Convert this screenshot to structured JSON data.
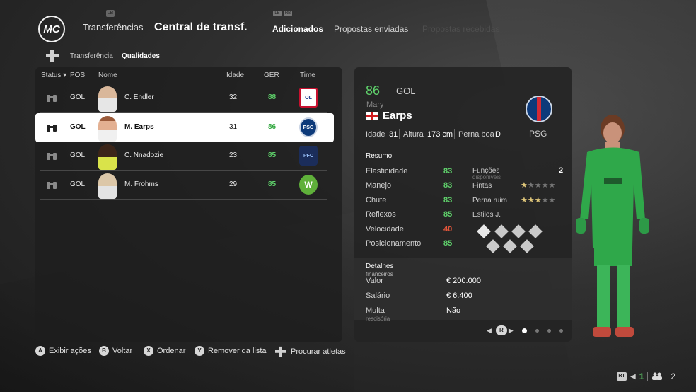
{
  "header": {
    "logo": "MC",
    "transfer_label": "Transferências",
    "title": "Central de transf.",
    "tabs": [
      "Adicionados",
      "Propostas enviadas",
      "Propostas recebidas"
    ]
  },
  "subtabs": [
    "Transferência",
    "Qualidades"
  ],
  "table": {
    "columns": [
      "Status",
      "POS",
      "Nome",
      "Idade",
      "GER",
      "Time"
    ],
    "rows": [
      {
        "pos": "GOL",
        "name": "C. Endler",
        "age": "32",
        "ger": "88",
        "team": "OL"
      },
      {
        "pos": "GOL",
        "name": "M. Earps",
        "age": "31",
        "ger": "86",
        "team": "PSG"
      },
      {
        "pos": "GOL",
        "name": "C. Nnadozie",
        "age": "23",
        "ger": "85",
        "team": "PFC"
      },
      {
        "pos": "GOL",
        "name": "M. Frohms",
        "age": "29",
        "ger": "85",
        "team": "W"
      }
    ]
  },
  "player": {
    "rating": "86",
    "position": "GOL",
    "first_name": "Mary",
    "last_name": "Earps",
    "age_label": "Idade",
    "age": "31",
    "height_label": "Altura",
    "height": "173 cm",
    "foot_label": "Perna boa",
    "foot": "D",
    "club": "PSG",
    "summary_title": "Resumo",
    "attributes": [
      {
        "label": "Elasticidade",
        "value": "83"
      },
      {
        "label": "Manejo",
        "value": "83"
      },
      {
        "label": "Chute",
        "value": "83"
      },
      {
        "label": "Reflexos",
        "value": "85"
      },
      {
        "label": "Velocidade",
        "value": "40"
      },
      {
        "label": "Posicionamento",
        "value": "85"
      }
    ],
    "functions_label": "Funções",
    "functions_sub": "disponíveis",
    "functions_value": "2",
    "skill_label": "Fintas",
    "skill_stars": 1,
    "weak_foot_label": "Perna ruim",
    "weak_foot_stars": 3,
    "styles_label": "Estilos J.",
    "finance_title": "Detalhes",
    "finance_sub": "financeiros",
    "value_label": "Valor",
    "value": "€ 200.000",
    "salary_label": "Salário",
    "salary": "€ 6.400",
    "release_label": "Multa",
    "release_sub": "rescisória",
    "release": "Não"
  },
  "hints": [
    {
      "btn": "A",
      "label": "Exibir ações"
    },
    {
      "btn": "B",
      "label": "Voltar"
    },
    {
      "btn": "X",
      "label": "Ordenar"
    },
    {
      "btn": "Y",
      "label": "Remover da lista"
    },
    {
      "btn": "",
      "label": "Procurar atletas"
    }
  ],
  "footer": {
    "rt": "RT",
    "count1": "1",
    "count2": "2"
  },
  "colors": {
    "accent_green": "#5fd16b",
    "warning_red": "#e5563b"
  }
}
